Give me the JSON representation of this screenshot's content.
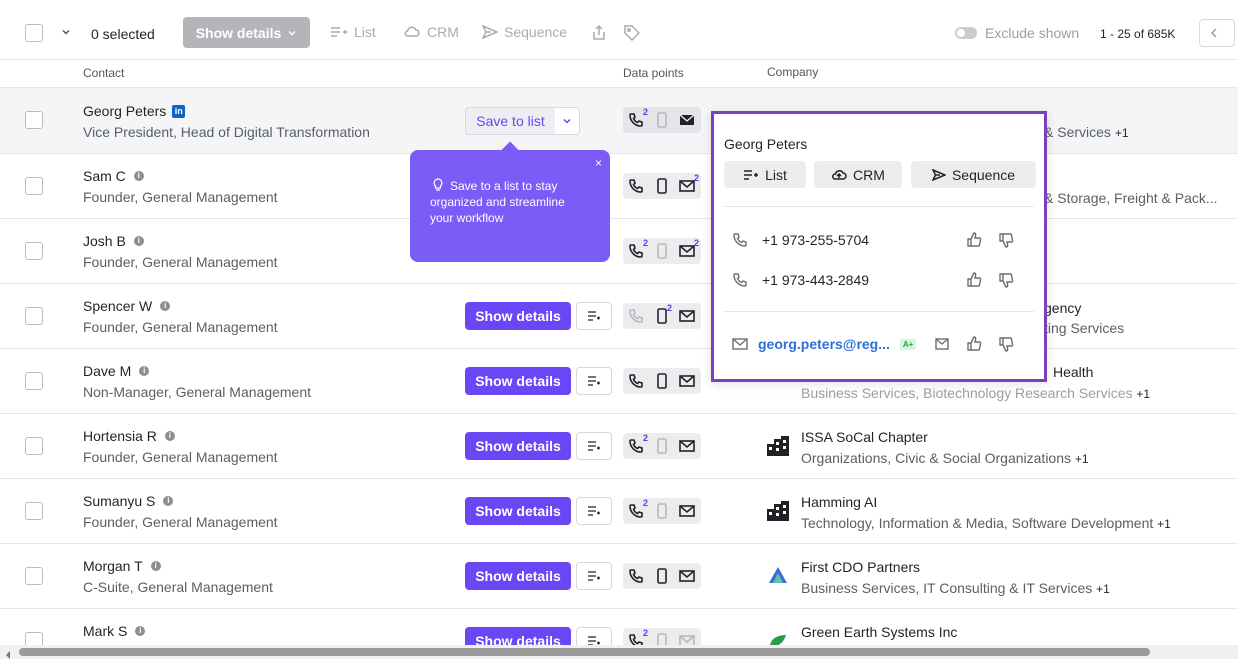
{
  "toolbar": {
    "selected_count": "0 selected",
    "show_details": "Show details",
    "list": "List",
    "crm": "CRM",
    "sequence": "Sequence",
    "exclude_shown": "Exclude shown",
    "pagination": "1 - 25 of 685K"
  },
  "headers": {
    "contact": "Contact",
    "data_points": "Data points",
    "company": "Company"
  },
  "save_to_list": "Save to list",
  "tooltip": {
    "text": "Save to a list to stay organized and streamline your workflow",
    "close": "×"
  },
  "popover": {
    "name": "Georg Peters",
    "list": "List",
    "crm": "CRM",
    "sequence": "Sequence",
    "phone1": "+1 973-255-5704",
    "phone2": "+1 973-443-2849",
    "email": "georg.peters@reg...",
    "email_grade": "A+"
  },
  "rows": [
    {
      "name": "Georg Peters",
      "title": "Vice President, Head of Digital Transformation",
      "company": "",
      "industry": "& Services",
      "more": "+1"
    },
    {
      "name": "Sam C",
      "title": "Founder, General Management",
      "company": "",
      "industry": "& Storage, Freight & Pack...",
      "more": ""
    },
    {
      "name": "Josh B",
      "title": "Founder, General Management",
      "company": "",
      "industry": "",
      "more": ""
    },
    {
      "name": "Spencer W",
      "title": "Founder, General Management",
      "company": "gency",
      "industry": "ting Services",
      "more": ""
    },
    {
      "name": "Dave M",
      "title": "Non-Manager, General Management",
      "company": "Health",
      "industry": "Business Services, Biotechnology Research Services",
      "more": "+1"
    },
    {
      "name": "Hortensia R",
      "title": "Founder, General Management",
      "company": "ISSA SoCal Chapter",
      "industry": "Organizations, Civic & Social Organizations",
      "more": "+1"
    },
    {
      "name": "Sumanyu S",
      "title": "Founder, General Management",
      "company": "Hamming AI",
      "industry": "Technology, Information & Media, Software Development",
      "more": "+1"
    },
    {
      "name": "Morgan T",
      "title": "C-Suite, General Management",
      "company": "First CDO Partners",
      "industry": "Business Services, IT Consulting & IT Services",
      "more": "+1"
    },
    {
      "name": "Mark S",
      "title": "",
      "company": "Green Earth Systems Inc",
      "industry": "",
      "more": ""
    }
  ],
  "show_details_label": "Show details",
  "dp_counts": {
    "two": "2"
  },
  "colors": {
    "accent": "#6b46f5",
    "popover_border": "#7b3fbf",
    "link": "#2e6fd8"
  }
}
